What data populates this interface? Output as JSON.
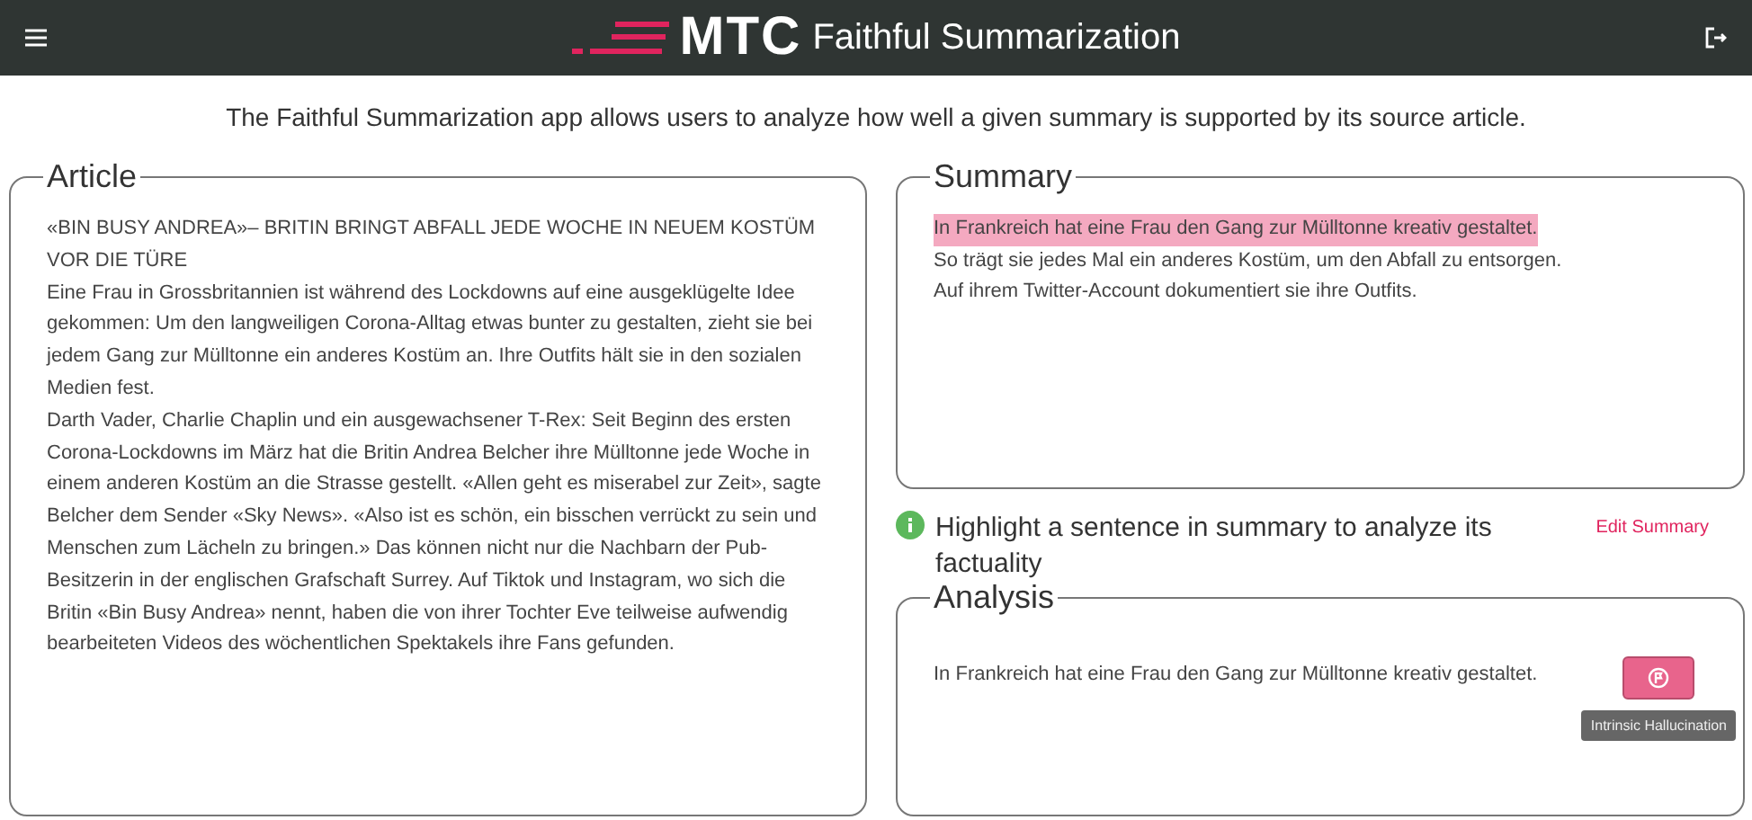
{
  "header": {
    "logo": "MTC",
    "title": "Faithful Summarization"
  },
  "intro": "The Faithful Summarization app allows users to analyze how well a given summary is supported by its source article.",
  "article": {
    "legend": "Article",
    "paragraphs": [
      "«BIN BUSY ANDREA»– BRITIN BRINGT ABFALL JEDE WOCHE IN NEUEM KOSTÜM VOR DIE TÜRE",
      "Eine Frau in Grossbritannien ist während des Lockdowns auf eine ausgeklügelte Idee gekommen: Um den langweiligen Corona-Alltag etwas bunter zu gestalten, zieht sie bei jedem Gang zur Mülltonne ein anderes Kostüm an. Ihre Outfits hält sie in den sozialen Medien fest.",
      "Darth Vader, Charlie Chaplin und ein ausgewachsener T-Rex: Seit Beginn des ersten Corona-Lockdowns im März hat die Britin Andrea Belcher ihre Mülltonne jede Woche in einem anderen Kostüm an die Strasse gestellt. «Allen geht es miserabel zur Zeit», sagte Belcher dem Sender «Sky News». «Also ist es schön, ein bisschen verrückt zu sein und Menschen zum Lächeln zu bringen.» Das können nicht nur die Nachbarn der Pub-Besitzerin in der englischen Grafschaft Surrey. Auf Tiktok und Instagram, wo sich die Britin «Bin Busy Andrea» nennt, haben die von ihrer Tochter Eve teilweise aufwendig bearbeiteten Videos des wöchentlichen Spektakels ihre Fans gefunden."
    ]
  },
  "summary": {
    "legend": "Summary",
    "sentences": [
      {
        "text": "In Frankreich hat eine Frau den Gang zur Mülltonne kreativ gestaltet.",
        "selected": true
      },
      {
        "text": "So trägt sie jedes Mal ein anderes Kostüm, um den Abfall zu entsorgen.",
        "selected": false
      },
      {
        "text": "Auf ihrem Twitter-Account dokumentiert sie ihre Outfits.",
        "selected": false
      }
    ]
  },
  "hint": "Highlight a sentence in summary to analyze its factuality",
  "edit_link": "Edit Summary",
  "analysis": {
    "legend": "Analysis",
    "sentence": "In Frankreich hat eine Frau den Gang zur Mülltonne kreativ gestaltet.",
    "tooltip": "Intrinsic Hallucination"
  }
}
